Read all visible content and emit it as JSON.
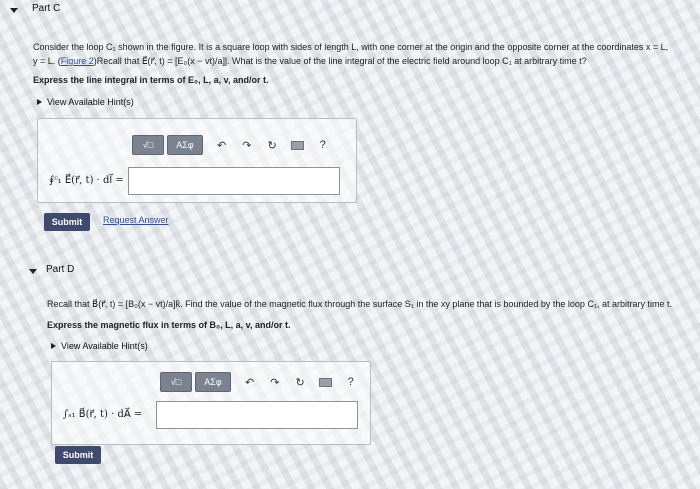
{
  "partC": {
    "title": "Part C",
    "line1": "Consider the loop C₁ shown in the figure. It is a square loop with sides of length L, with one corner at the origin and the opposite corner at the coordinates x = L,",
    "line2_a": "y = L. (",
    "figure_link": "Figure 2",
    "line2_b": ")Recall that E⃗(r⃗, t) = [E₀(x − vt)/a]ĵ. What is the value of the line integral of the electric field around loop C₁ at arbitrary time t?",
    "instruction": "Express the line integral in terms of E₀, L, a, v, and/or t.",
    "hints_label": "View Available Hint(s)",
    "expression_label": "∮ᶜ₁ E⃗(r⃗, t) · dl⃗ =",
    "submit_label": "Submit",
    "request_label": "Request Answer"
  },
  "partD": {
    "title": "Part D",
    "line1": "Recall that B⃗(r⃗, t) = [B₀(x − vt)/a]k̂. Find the value of the magnetic flux through the surface S₁ in the xy plane that is bounded by the loop C₁, at arbitrary time t.",
    "instruction": "Express the magnetic flux in terms of B₀, L, a, v, and/or t.",
    "hints_label": "View Available Hint(s)",
    "expression_label": "∫ₛ₁ B⃗(r⃗, t) · dA⃗ =",
    "submit_label": "Submit"
  },
  "toolbar": {
    "template_label": "√□",
    "greek_label": "AΣφ",
    "help_label": "?"
  },
  "icons": [
    "undo-icon",
    "redo-icon",
    "reset-icon",
    "keyboard-icon",
    "help-icon"
  ]
}
